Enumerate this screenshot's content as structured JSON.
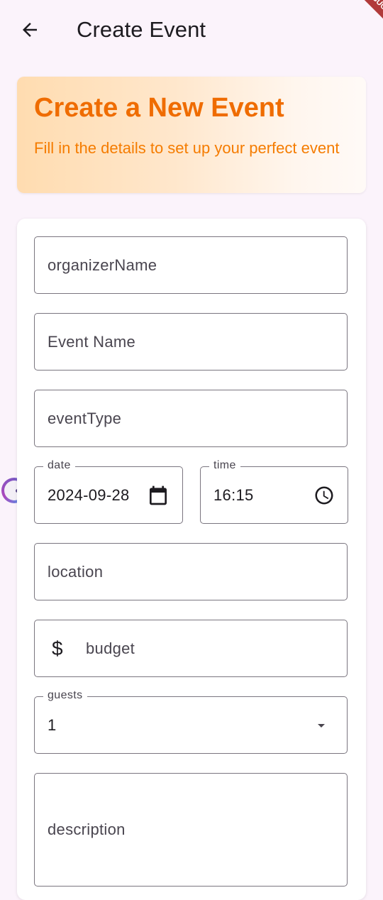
{
  "appbar": {
    "title": "Create Event",
    "back_icon": "arrow-back-icon",
    "debug_banner": "DEBUG"
  },
  "hero": {
    "title": "Create a New Event",
    "subtitle": "Fill in the details to set up your perfect event"
  },
  "form": {
    "organizer_name": {
      "placeholder": "organizerName"
    },
    "event_name": {
      "placeholder": "Event Name"
    },
    "event_type": {
      "placeholder": "eventType"
    },
    "date": {
      "label": "date",
      "value": "2024-09-28",
      "icon": "calendar-icon"
    },
    "time": {
      "label": "time",
      "value": "16:15",
      "icon": "clock-icon"
    },
    "location": {
      "placeholder": "location"
    },
    "budget": {
      "placeholder": "budget",
      "prefix": "$"
    },
    "guests": {
      "label": "guests",
      "value": "1",
      "icon": "dropdown-arrow-icon"
    },
    "description": {
      "placeholder": "description"
    }
  },
  "colors": {
    "accent": "#ef6c00",
    "subtitle": "#f57c00",
    "background": "#fbf3fb",
    "outline": "#7a757f"
  }
}
